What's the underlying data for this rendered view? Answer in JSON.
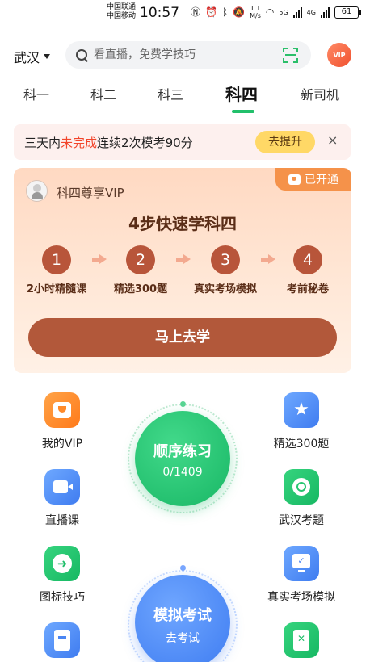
{
  "status_bar": {
    "carrier1": "中国联通",
    "carrier2": "中国移动",
    "time": "10:57",
    "speed_top": "1.1",
    "speed_bottom": "M/s",
    "net1": "5G",
    "net2": "4G",
    "battery": "61"
  },
  "header": {
    "city": "武汉",
    "search_placeholder": "看直播，免费学技巧",
    "vip_badge": "VIP"
  },
  "tabs": [
    {
      "label": "科一",
      "active": false
    },
    {
      "label": "科二",
      "active": false
    },
    {
      "label": "科三",
      "active": false
    },
    {
      "label": "科四",
      "active": true
    },
    {
      "label": "新司机",
      "active": false
    }
  ],
  "promo": {
    "text_before": "三天内",
    "text_highlight": "未完成",
    "text_after": "连续2次模考90分",
    "button": "去提升",
    "close": "×"
  },
  "vip_card": {
    "badge": "已开通",
    "name": "科四尊享VIP",
    "headline": "4步快速学科四",
    "steps": [
      {
        "num": "1",
        "label": "2小时精髓课"
      },
      {
        "num": "2",
        "label": "精选300题"
      },
      {
        "num": "3",
        "label": "真实考场模拟"
      },
      {
        "num": "4",
        "label": "考前秘卷"
      }
    ],
    "button": "马上去学"
  },
  "features": {
    "left": [
      "我的VIP",
      "直播课",
      "图标技巧"
    ],
    "right": [
      "精选300题",
      "武汉考题",
      "真实考场模拟"
    ]
  },
  "practice": {
    "title": "顺序练习",
    "progress": "0/1409"
  },
  "exam": {
    "title": "模拟考试",
    "sub": "去考试"
  },
  "colors": {
    "accent_green": "#22c06b",
    "highlight_red": "#f2452b",
    "vip_brown": "#b2583a",
    "blue": "#3f7cf0"
  }
}
